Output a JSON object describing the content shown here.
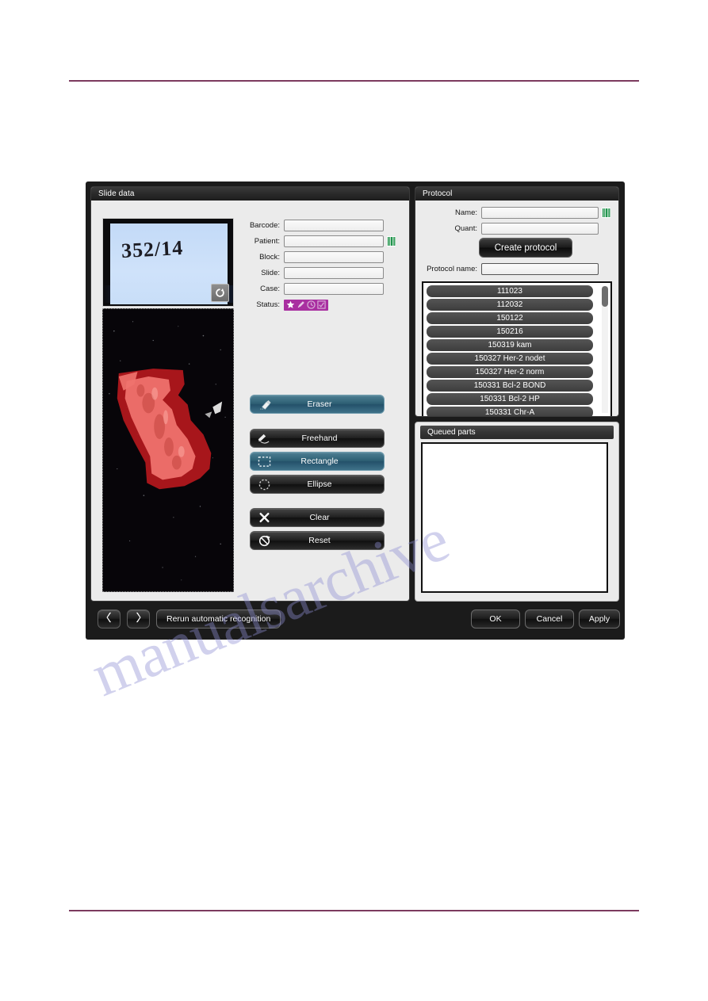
{
  "page": {
    "rule_color": "#7c3a5e",
    "watermark_text": "manualsarchive"
  },
  "slide_panel": {
    "title": "Slide data",
    "label_thumbnail": {
      "handwriting": "352/14",
      "refresh_icon": "refresh-icon"
    },
    "fields": [
      {
        "label": "Barcode:",
        "value": "",
        "placeholder": "",
        "barcode_icon": false
      },
      {
        "label": "Patient:",
        "value": "",
        "placeholder": "",
        "barcode_icon": true
      },
      {
        "label": "Block:",
        "value": "",
        "placeholder": "",
        "barcode_icon": false
      },
      {
        "label": "Slide:",
        "value": "",
        "placeholder": "",
        "barcode_icon": false
      },
      {
        "label": "Case:",
        "value": "",
        "placeholder": "",
        "barcode_icon": false
      }
    ],
    "status": {
      "label": "Status:",
      "badge_color": "#a92fa0",
      "icons": [
        "star-icon",
        "pencil-icon",
        "clock-icon",
        "checkbox-icon"
      ]
    }
  },
  "tools": {
    "eraser": {
      "label": "Eraser",
      "icon": "eraser-icon",
      "active": true
    },
    "shapes": [
      {
        "label": "Freehand",
        "icon": "freehand-pencil-icon",
        "active": false
      },
      {
        "label": "Rectangle",
        "icon": "rectangle-marquee-icon",
        "active": true
      },
      {
        "label": "Ellipse",
        "icon": "ellipse-marquee-icon",
        "active": false
      }
    ],
    "commands": [
      {
        "label": "Clear",
        "icon": "cross-icon",
        "active": false
      },
      {
        "label": "Reset",
        "icon": "reset-circle-icon",
        "active": false
      }
    ],
    "active_color": "#3f7289"
  },
  "protocol_panel": {
    "title": "Protocol",
    "fields": [
      {
        "label": "Name:",
        "value": "",
        "placeholder": "",
        "barcode_icon": true
      },
      {
        "label": "Quant:",
        "value": "",
        "placeholder": "",
        "barcode_icon": false
      }
    ],
    "create_button": "Create protocol",
    "protocol_name": {
      "label": "Protocol name:",
      "value": "",
      "placeholder": ""
    },
    "list_items": [
      "111023",
      "112032",
      "150122",
      "150216",
      "150319 kam",
      "150327 Her-2 nodet",
      "150327 Her-2 norm",
      "150331 Bcl-2 BOND",
      "150331 Bcl-2 HP",
      "150331 Chr-A"
    ]
  },
  "queued_panel": {
    "title": "Queued parts",
    "items": []
  },
  "bottom_bar": {
    "prev_icon": "chevron-left-icon",
    "next_icon": "chevron-right-icon",
    "rerun_label": "Rerun automatic recognition",
    "ok_label": "OK",
    "cancel_label": "Cancel",
    "apply_label": "Apply"
  }
}
